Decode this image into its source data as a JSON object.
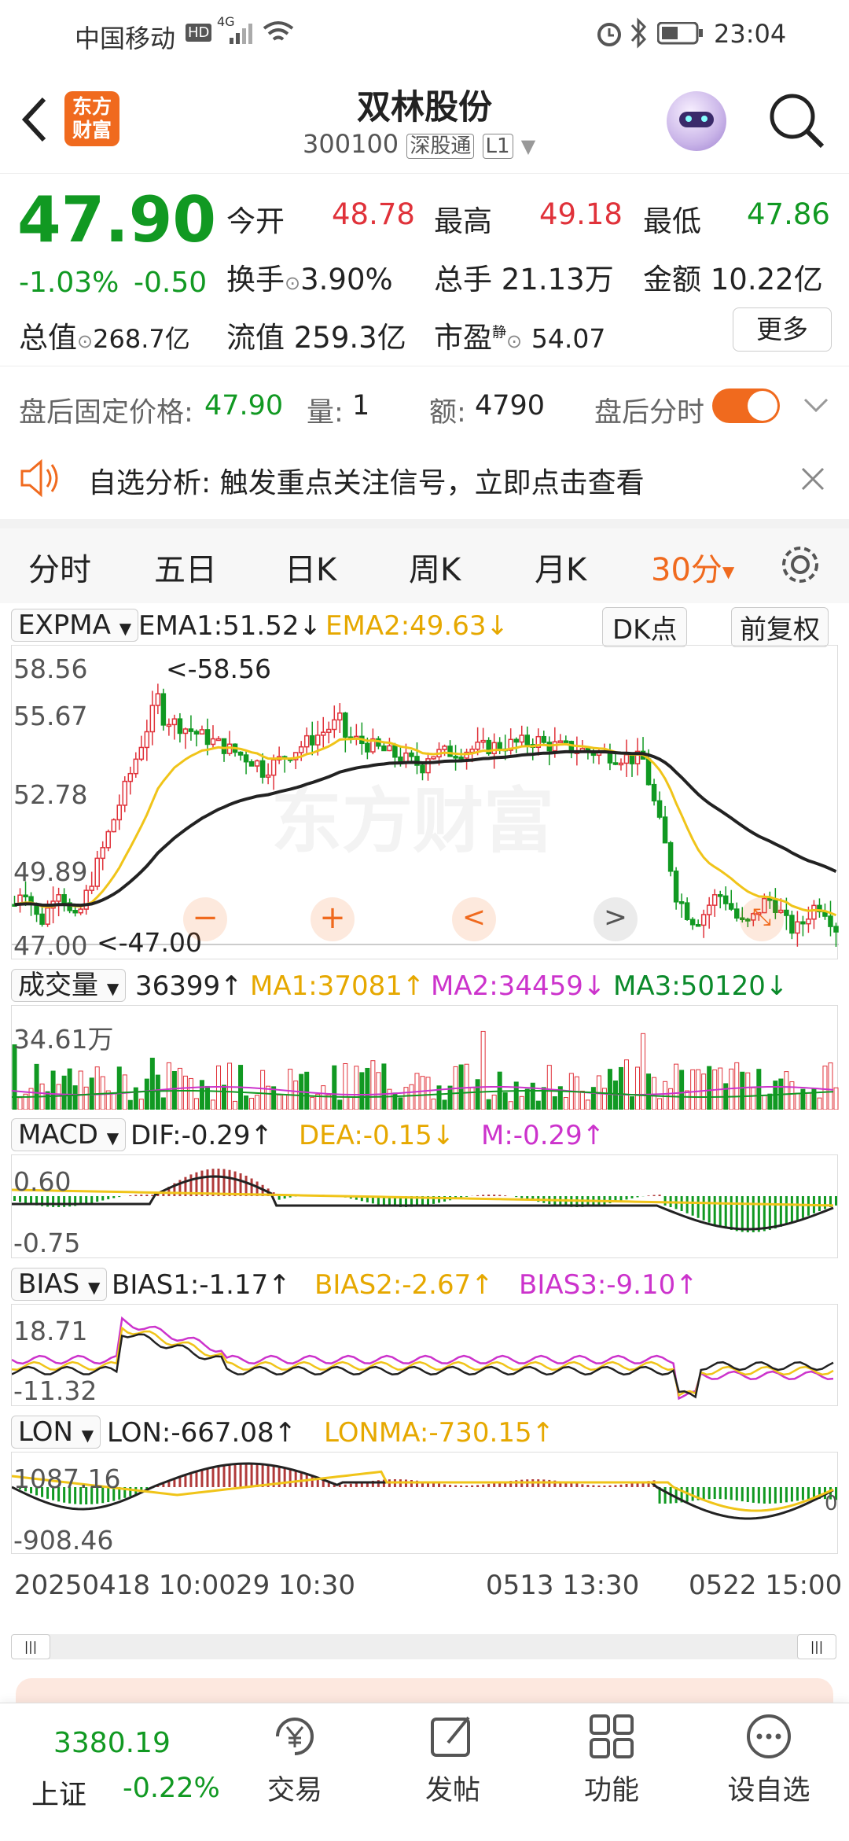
{
  "status": {
    "carrier": "中国移动",
    "hd": "HD",
    "net": "4G",
    "time": "23:04"
  },
  "header": {
    "logo_line1": "东方",
    "logo_line2": "财富",
    "title": "双林股份",
    "code": "300100",
    "market_tag": "深股通",
    "level_tag": "L1"
  },
  "quote": {
    "price": "47.90",
    "change_pct": "-1.03%",
    "change": "-0.50",
    "open_label": "今开",
    "open": "48.78",
    "high_label": "最高",
    "high": "49.18",
    "low_label": "最低",
    "low": "47.86",
    "turnover_label": "换手",
    "turnover": "3.90%",
    "volume_label": "总手",
    "volume": "21.13万",
    "amount_label": "金额",
    "amount": "10.22亿",
    "mktcap_label": "总值",
    "mktcap": "268.7亿",
    "float_label": "流值",
    "float_cap": "259.3亿",
    "pe_label": "市盈",
    "pe_sup": "静",
    "pe": "54.07",
    "more_label": "更多"
  },
  "after_hours": {
    "label": "盘后固定价格:",
    "price": "47.90",
    "vol_label": "量:",
    "vol": "1",
    "amt_label": "额:",
    "amt": "4790",
    "toggle_label": "盘后分时",
    "toggle_on": true
  },
  "notice": {
    "text": "自选分析: 触发重点关注信号，立即点击查看"
  },
  "tabs": [
    {
      "label": "分时"
    },
    {
      "label": "五日"
    },
    {
      "label": "日K"
    },
    {
      "label": "周K"
    },
    {
      "label": "月K"
    },
    {
      "label": "30分",
      "active": true
    }
  ],
  "expma": {
    "selector": "EXPMA",
    "ema1": "EMA1:51.52↓",
    "ema2": "EMA2:49.63↓",
    "dk": "DK点",
    "fq": "前复权",
    "y_labels": [
      "58.56",
      "55.67",
      "52.78",
      "49.89",
      "47.00"
    ],
    "max_mark": "<-58.56",
    "min_mark": "<-47.00"
  },
  "volume": {
    "selector": "成交量",
    "val": "36399↑",
    "ma1": "MA1:37081↑",
    "ma2": "MA2:34459↓",
    "ma3": "MA3:50120↓",
    "y_top": "34.61万"
  },
  "macd": {
    "selector": "MACD",
    "dif": "DIF:-0.29↑",
    "dea": "DEA:-0.15↓",
    "m": "M:-0.29↑",
    "y_top": "0.60",
    "y_bot": "-0.75"
  },
  "bias": {
    "selector": "BIAS",
    "b1": "BIAS1:-1.17↑",
    "b2": "BIAS2:-2.67↑",
    "b3": "BIAS3:-9.10↑",
    "y_top": "18.71",
    "y_bot": "-11.32"
  },
  "lon": {
    "selector": "LON",
    "lon": "LON:-667.08↑",
    "lonma": "LONMA:-730.15↑",
    "y_top": "1087.16",
    "y_bot": "-908.46",
    "zero": "0"
  },
  "time_axis": {
    "t1": "20250418 10:00",
    "t2": "29 10:30",
    "t3": "0513 13:30",
    "t4": "0522 15:00"
  },
  "bottom_nav": [
    {
      "index_value": "3380.19",
      "index_name": "上证",
      "index_change": "-0.22%"
    },
    {
      "label": "交易"
    },
    {
      "label": "发帖"
    },
    {
      "label": "功能"
    },
    {
      "label": "设自选"
    }
  ],
  "colors": {
    "up": "#e0323a",
    "down": "#119922",
    "accent": "#f06a1e",
    "ema2": "#f0c419",
    "ma": "#cc33cc"
  }
}
